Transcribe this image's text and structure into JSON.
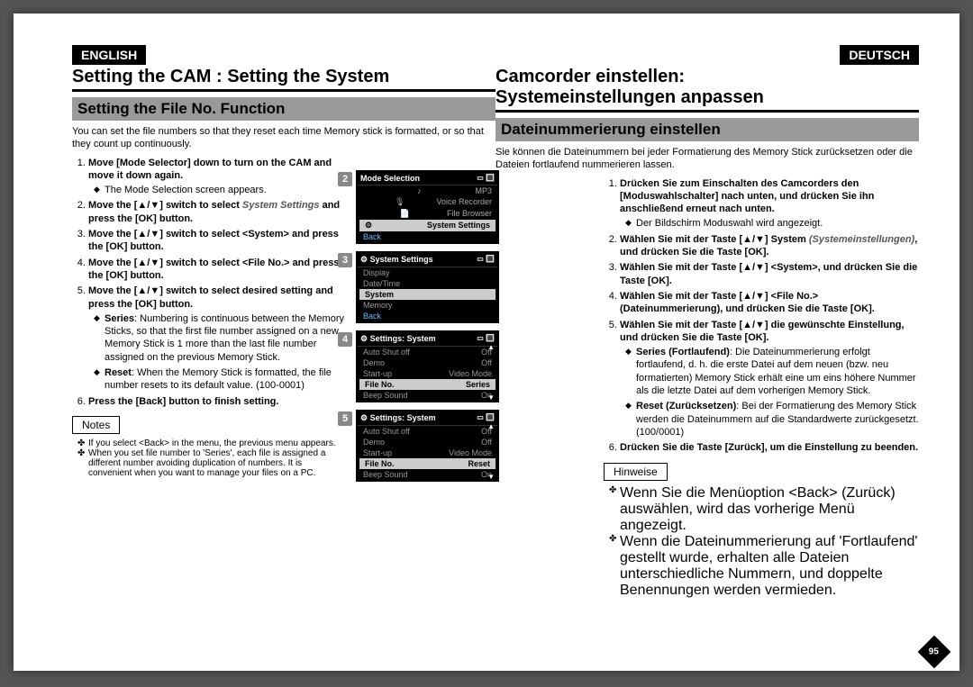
{
  "colors": {
    "accent": "#000",
    "sub_bg": "#999",
    "screen_bg": "#000",
    "hilite": "#ccc"
  },
  "left": {
    "lang": "ENGLISH",
    "title": "Setting the CAM : Setting the System",
    "subtitle": "Setting the File No. Function",
    "intro": "You can set the file numbers so that they reset each time Memory stick is formatted, or so that they count up continuously.",
    "steps": [
      {
        "bold": "Move [Mode Selector] down to turn on the CAM and move it down again.",
        "sub": [
          "The Mode Selection screen appears."
        ]
      },
      {
        "bold": "Move the [▲/▼] switch to select ",
        "ital": "System Settings",
        "after": " and press the [OK] button."
      },
      {
        "bold": "Move the [▲/▼] switch to select <System> and press the [OK] button."
      },
      {
        "bold": "Move the [▲/▼] switch to select <File No.> and press the [OK] button."
      },
      {
        "bold": "Move the [▲/▼] switch to select desired setting and press the [OK] button.",
        "sub": [
          {
            "b": "Series",
            "t": ": Numbering is continuous between the Memory Sticks, so that the first file number assigned on a new Memory Stick is 1 more than the last file number assigned on the previous Memory Stick."
          },
          {
            "b": "Reset",
            "t": ": When the Memory Stick is formatted, the file number resets to its default value. (100-0001)"
          }
        ]
      },
      {
        "bold": "Press the [Back] button to finish setting."
      }
    ],
    "notes_label": "Notes",
    "notes": [
      "If you select <Back> in the menu, the previous menu appears.",
      "When you set file number to 'Series', each file is assigned a different number avoiding duplication of numbers. It is convenient when you want to manage your files on a PC."
    ]
  },
  "right": {
    "lang": "DEUTSCH",
    "title1": "Camcorder einstellen:",
    "title2": "Systemeinstellungen anpassen",
    "subtitle": "Dateinummerierung einstellen",
    "intro": "Sie können die Dateinummern bei jeder Formatierung des Memory Stick zurücksetzen oder die Dateien fortlaufend nummerieren lassen.",
    "steps": [
      {
        "bold": "Drücken Sie zum Einschalten des Camcorders den [Moduswahlschalter] nach unten, und drücken Sie ihn anschließend erneut nach unten.",
        "sub": [
          "Der Bildschirm Moduswahl wird angezeigt."
        ]
      },
      {
        "bold": "Wählen Sie mit der Taste [▲/▼] System ",
        "ital": "(Systemeinstellungen)",
        "after": ", und drücken Sie die Taste [OK]."
      },
      {
        "bold": "Wählen Sie mit der Taste [▲/▼] <System>, und drücken Sie die Taste [OK]."
      },
      {
        "bold": "Wählen Sie mit der Taste [▲/▼] <File No.> (Dateinummerierung), und drücken Sie die Taste [OK]."
      },
      {
        "bold": "Wählen Sie mit der Taste [▲/▼] die gewünschte Einstellung, und drücken Sie die Taste [OK].",
        "sub": [
          {
            "b": "Series (Fortlaufend)",
            "t": ": Die Dateinummerierung erfolgt fortlaufend, d. h. die erste Datei auf dem neuen (bzw. neu formatierten) Memory Stick erhält eine um eins höhere Nummer als die letzte Datei auf dem vorherigen Memory Stick."
          },
          {
            "b": "Reset (Zurücksetzen)",
            "t": ": Bei der Formatierung des Memory Stick werden die Dateinummern auf die Standardwerte zurückgesetzt. (100/0001)"
          }
        ]
      },
      {
        "bold": "Drücken Sie die Taste [Zurück], um die Einstellung zu beenden."
      }
    ],
    "notes_label": "Hinweise",
    "notes": [
      "Wenn Sie die Menüoption <Back> (Zurück) auswählen, wird das vorherige Menü angezeigt.",
      "Wenn die Dateinummerierung auf 'Fortlaufend' gestellt wurde, erhalten alle Dateien unterschiedliche Nummern, und doppelte Benennungen werden vermieden."
    ]
  },
  "screens": {
    "s2": {
      "num": "2",
      "title": "Mode Selection",
      "rows": [
        {
          "l": "MP3"
        },
        {
          "l": "Voice Recorder"
        },
        {
          "l": "File Browser"
        }
      ],
      "hi": "System Settings",
      "back": "Back"
    },
    "s3": {
      "num": "3",
      "title": "System Settings",
      "rows": [
        {
          "l": "Display"
        },
        {
          "l": "Date/Time"
        }
      ],
      "hi": "System",
      "rows2": [
        {
          "l": "Memory"
        }
      ],
      "back": "Back"
    },
    "s4": {
      "num": "4",
      "title": "Settings: System",
      "rows": [
        {
          "l": "Auto Shut off",
          "r": "Off"
        },
        {
          "l": "Demo",
          "r": "Off"
        },
        {
          "l": "Start-up",
          "r": "Video Mode"
        }
      ],
      "hi_l": "File No.",
      "hi_r": "Series",
      "rows2": [
        {
          "l": "Beep Sound",
          "r": "On"
        }
      ]
    },
    "s5": {
      "num": "5",
      "title": "Settings: System",
      "rows": [
        {
          "l": "Auto Shut off",
          "r": "Off"
        },
        {
          "l": "Demo",
          "r": "Off"
        },
        {
          "l": "Start-up",
          "r": "Video Mode"
        }
      ],
      "hi_l": "File No.",
      "hi_r": "Reset",
      "rows2": [
        {
          "l": "Beep Sound",
          "r": "On"
        }
      ]
    }
  },
  "page_number": "95"
}
